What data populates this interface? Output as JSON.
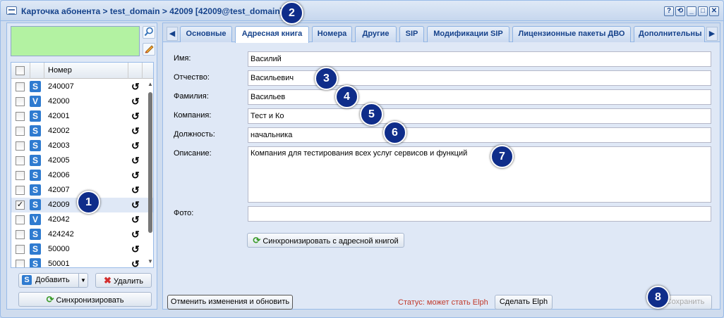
{
  "window": {
    "title": "Карточка абонента > test_domain > 42009 [42009@test_domain]",
    "title_buttons": [
      "?",
      "⟲",
      "_",
      "□",
      "✕"
    ]
  },
  "left_panel": {
    "filter_value": "",
    "grid": {
      "column_header": "Номер",
      "rows": [
        {
          "type": "S",
          "number": "240007",
          "checked": false,
          "selected": false
        },
        {
          "type": "V",
          "number": "42000",
          "checked": false,
          "selected": false
        },
        {
          "type": "S",
          "number": "42001",
          "checked": false,
          "selected": false
        },
        {
          "type": "S",
          "number": "42002",
          "checked": false,
          "selected": false
        },
        {
          "type": "S",
          "number": "42003",
          "checked": false,
          "selected": false
        },
        {
          "type": "S",
          "number": "42005",
          "checked": false,
          "selected": false
        },
        {
          "type": "S",
          "number": "42006",
          "checked": false,
          "selected": false
        },
        {
          "type": "S",
          "number": "42007",
          "checked": false,
          "selected": false
        },
        {
          "type": "S",
          "number": "42009",
          "checked": true,
          "selected": true
        },
        {
          "type": "V",
          "number": "42042",
          "checked": false,
          "selected": false
        },
        {
          "type": "S",
          "number": "424242",
          "checked": false,
          "selected": false
        },
        {
          "type": "S",
          "number": "50000",
          "checked": false,
          "selected": false
        },
        {
          "type": "S",
          "number": "50001",
          "checked": false,
          "selected": false
        }
      ]
    },
    "add_button": "Добавить",
    "delete_button": "Удалить",
    "sync_button": "Синхронизировать"
  },
  "tabs": [
    "Основные",
    "Адресная книга",
    "Номера",
    "Другие",
    "SIP",
    "Модификации SIP",
    "Лицензионные пакеты ДВО",
    "Дополнительны"
  ],
  "active_tab": 1,
  "form": {
    "name_label": "Имя:",
    "name_value": "Василий",
    "patronymic_label": "Отчество:",
    "patronymic_value": "Васильевич",
    "surname_label": "Фамилия:",
    "surname_value": "Васильев",
    "company_label": "Компания:",
    "company_value": "Тест и Ко",
    "position_label": "Должность:",
    "position_value": "начальника",
    "description_label": "Описание:",
    "description_value": "Компания для тестирования всех услуг сервисов и функций",
    "photo_label": "Фото:",
    "photo_value": "",
    "sync_addressbook_button": "Синхронизировать с адресной книгой"
  },
  "footer": {
    "cancel_button": "Отменить изменения и обновить",
    "status_text": "Статус: может стать Elph",
    "make_elph_button": "Сделать Elph",
    "save_button": "Сохранить"
  },
  "markers": [
    "1",
    "2",
    "3",
    "4",
    "5",
    "6",
    "7",
    "8"
  ],
  "colors": {
    "accent": "#15428b",
    "filter_bg": "#b3f2a2",
    "marker": "#0f2d8a",
    "status": "#c0392b"
  }
}
